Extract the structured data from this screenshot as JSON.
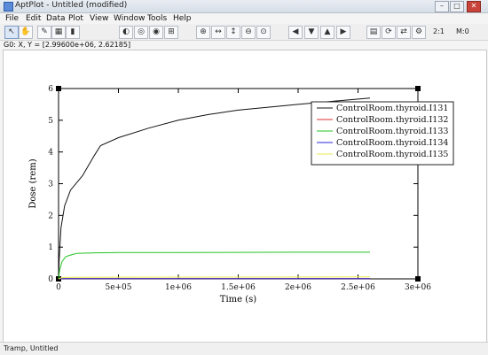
{
  "window": {
    "title": "AptPlot - Untitled (modified)",
    "minimize_label": "–",
    "maximize_label": "□",
    "close_label": "✕"
  },
  "menubar": {
    "items": [
      "File",
      "Edit",
      "Data",
      "Plot",
      "View",
      "Window",
      "Tools",
      "Help"
    ]
  },
  "toolbar": {
    "zoom_ratio": "2:1",
    "zoom_level": "M:0"
  },
  "coord_readout": "G0: X, Y = [2.99600e+06, 2.62185]",
  "chart_data": {
    "type": "line",
    "xlabel": "Time (s)",
    "ylabel": "Dose (rem)",
    "xlim": [
      0,
      3000000
    ],
    "ylim": [
      0,
      6
    ],
    "x_ticks": [
      {
        "value": 0,
        "label": "0"
      },
      {
        "value": 500000,
        "label": "5e+05"
      },
      {
        "value": 1000000,
        "label": "1e+06"
      },
      {
        "value": 1500000,
        "label": "1.5e+06"
      },
      {
        "value": 2000000,
        "label": "2e+06"
      },
      {
        "value": 2500000,
        "label": "2.5e+06"
      },
      {
        "value": 3000000,
        "label": "3e+06"
      }
    ],
    "y_ticks": [
      {
        "value": 0,
        "label": "0"
      },
      {
        "value": 1,
        "label": "1"
      },
      {
        "value": 2,
        "label": "2"
      },
      {
        "value": 3,
        "label": "3"
      },
      {
        "value": 4,
        "label": "4"
      },
      {
        "value": 5,
        "label": "5"
      },
      {
        "value": 6,
        "label": "6"
      }
    ],
    "grid": false,
    "legend_position": "top-right",
    "series": [
      {
        "name": "ControlRoom.thyroid.I131",
        "color": "#111111",
        "points": [
          [
            0,
            0
          ],
          [
            5000,
            0.6
          ],
          [
            20000,
            1.6
          ],
          [
            50000,
            2.3
          ],
          [
            100000,
            2.8
          ],
          [
            200000,
            3.25
          ],
          [
            300000,
            3.9
          ],
          [
            350000,
            4.2
          ],
          [
            500000,
            4.45
          ],
          [
            750000,
            4.75
          ],
          [
            1000000,
            5.0
          ],
          [
            1250000,
            5.18
          ],
          [
            1500000,
            5.32
          ],
          [
            2000000,
            5.5
          ],
          [
            2300000,
            5.6
          ],
          [
            2600000,
            5.7
          ]
        ]
      },
      {
        "name": "ControlRoom.thyroid.I132",
        "color": "#e03030",
        "points": [
          [
            0,
            0
          ],
          [
            20000,
            0.01
          ],
          [
            2600000,
            0.01
          ]
        ]
      },
      {
        "name": "ControlRoom.thyroid.I133",
        "color": "#22c322",
        "points": [
          [
            0,
            0
          ],
          [
            10000,
            0.3
          ],
          [
            30000,
            0.55
          ],
          [
            60000,
            0.7
          ],
          [
            100000,
            0.75
          ],
          [
            150000,
            0.8
          ],
          [
            300000,
            0.82
          ],
          [
            500000,
            0.83
          ],
          [
            1000000,
            0.83
          ],
          [
            2000000,
            0.84
          ],
          [
            2600000,
            0.84
          ]
        ]
      },
      {
        "name": "ControlRoom.thyroid.I134",
        "color": "#2a2ad8",
        "points": [
          [
            0,
            0
          ],
          [
            20000,
            0.005
          ],
          [
            2600000,
            0.005
          ]
        ]
      },
      {
        "name": "ControlRoom.thyroid.I135",
        "color": "#e8e84a",
        "points": [
          [
            0,
            0
          ],
          [
            20000,
            0.03
          ],
          [
            60000,
            0.05
          ],
          [
            2600000,
            0.06
          ]
        ]
      }
    ]
  },
  "statusbar": {
    "text": "Tramp, Untitled"
  }
}
